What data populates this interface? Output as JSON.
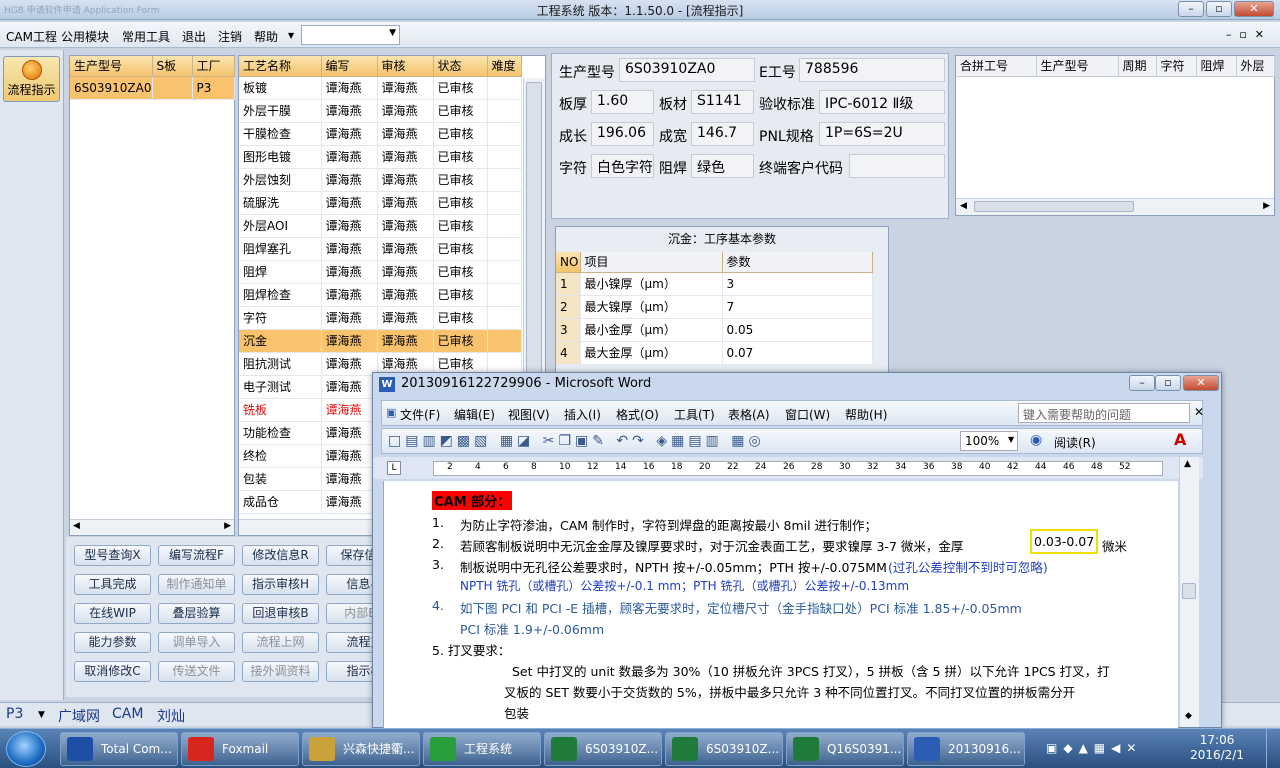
{
  "window": {
    "title": "工程系统  版本：1.1.50.0 - [流程指示]",
    "faded_caption": "HGB 申请软件申请 Application Form"
  },
  "menu": {
    "items": [
      "CAM工程",
      "公用模块",
      "常用工具",
      "退出",
      "注销",
      "帮助"
    ],
    "combo_value": ""
  },
  "nav": {
    "flow_label": "流程指示"
  },
  "product_grid": {
    "columns": [
      "生产型号",
      "S板",
      "工厂"
    ],
    "rows": [
      {
        "model": "6S03910ZA0",
        "sboard": "",
        "factory": "P3"
      }
    ]
  },
  "process_grid": {
    "columns": [
      "工艺名称",
      "编写",
      "审核",
      "状态",
      "难度"
    ],
    "rows": [
      {
        "name": "板镀",
        "writer": "谭海燕",
        "reviewer": "谭海燕",
        "status": "已审核"
      },
      {
        "name": "外层干膜",
        "writer": "谭海燕",
        "reviewer": "谭海燕",
        "status": "已审核"
      },
      {
        "name": "干膜检查",
        "writer": "谭海燕",
        "reviewer": "谭海燕",
        "status": "已审核"
      },
      {
        "name": "图形电镀",
        "writer": "谭海燕",
        "reviewer": "谭海燕",
        "status": "已审核"
      },
      {
        "name": "外层蚀刻",
        "writer": "谭海燕",
        "reviewer": "谭海燕",
        "status": "已审核"
      },
      {
        "name": "硫脲洗",
        "writer": "谭海燕",
        "reviewer": "谭海燕",
        "status": "已审核"
      },
      {
        "name": "外层AOI",
        "writer": "谭海燕",
        "reviewer": "谭海燕",
        "status": "已审核"
      },
      {
        "name": "阻焊塞孔",
        "writer": "谭海燕",
        "reviewer": "谭海燕",
        "status": "已审核"
      },
      {
        "name": "阻焊",
        "writer": "谭海燕",
        "reviewer": "谭海燕",
        "status": "已审核"
      },
      {
        "name": "阻焊检查",
        "writer": "谭海燕",
        "reviewer": "谭海燕",
        "status": "已审核"
      },
      {
        "name": "字符",
        "writer": "谭海燕",
        "reviewer": "谭海燕",
        "status": "已审核"
      },
      {
        "name": "沉金",
        "writer": "谭海燕",
        "reviewer": "谭海燕",
        "status": "已审核"
      },
      {
        "name": "阻抗测试",
        "writer": "谭海燕",
        "reviewer": "谭海燕",
        "status": "已审核"
      },
      {
        "name": "电子测试",
        "writer": "谭海燕",
        "reviewer": "",
        "status": ""
      },
      {
        "name": "铣板",
        "writer": "谭海燕",
        "reviewer": "",
        "status": ""
      },
      {
        "name": "功能检查",
        "writer": "谭海燕",
        "reviewer": "",
        "status": ""
      },
      {
        "name": "终检",
        "writer": "谭海燕",
        "reviewer": "",
        "status": ""
      },
      {
        "name": "包装",
        "writer": "谭海燕",
        "reviewer": "",
        "status": ""
      },
      {
        "name": "成品仓",
        "writer": "谭海燕",
        "reviewer": "",
        "status": ""
      }
    ]
  },
  "buttons": [
    [
      "型号查询X",
      "编写流程F",
      "修改信息R",
      "保存信息"
    ],
    [
      "工具完成",
      "制作通知单",
      "指示审核H",
      "信息导"
    ],
    [
      "在线WIP",
      "叠层验算",
      "回退审核B",
      "内部BC"
    ],
    [
      "能力参数",
      "调单导入",
      "流程上网",
      "流程对"
    ],
    [
      "取消修改C",
      "传送文件",
      "接外调资料",
      "指示检"
    ]
  ],
  "info": {
    "model_label": "生产型号",
    "model": "6S03910ZA0",
    "eno_label": "E工号",
    "eno": "788596",
    "thick_label": "板厚",
    "thick": "1.60",
    "material_label": "板材",
    "material": "S1141",
    "std_label": "验收标准",
    "std": "IPC-6012 Ⅱ级",
    "len_label": "成长",
    "len": "196.06",
    "wid_label": "成宽",
    "wid": "146.7",
    "pnl_label": "PNL规格",
    "pnl": "1P=6S=2U",
    "char_label": "字符",
    "char": "白色字符",
    "mask_label": "阻焊",
    "mask": "绿色",
    "cust_label": "终端客户代码",
    "cust": ""
  },
  "merge_grid": {
    "columns": [
      "合拼工号",
      "生产型号",
      "周期",
      "字符",
      "阻焊",
      "外层"
    ]
  },
  "params": {
    "title": "沉金：工序基本参数",
    "columns": [
      "NO",
      "项目",
      "参数"
    ],
    "rows": [
      {
        "no": "1",
        "item": "最小镍厚（μm）",
        "val": "3"
      },
      {
        "no": "2",
        "item": "最大镍厚（μm）",
        "val": "7"
      },
      {
        "no": "3",
        "item": "最小金厚（μm）",
        "val": "0.05"
      },
      {
        "no": "4",
        "item": "最大金厚（μm）",
        "val": "0.07"
      }
    ]
  },
  "status": {
    "plant": "P3",
    "net": "广域网",
    "module": "CAM",
    "user": "刘灿"
  },
  "word": {
    "title": "20130916122729906 - Microsoft Word",
    "menu": [
      "文件(F)",
      "编辑(E)",
      "视图(V)",
      "插入(I)",
      "格式(O)",
      "工具(T)",
      "表格(A)",
      "窗口(W)",
      "帮助(H)"
    ],
    "help_placeholder": "键入需要帮助的问题",
    "zoom": "100%",
    "read_label": "阅读(R)",
    "ruler": [
      "2",
      "4",
      "6",
      "8",
      "10",
      "12",
      "14",
      "16",
      "18",
      "20",
      "22",
      "24",
      "26",
      "28",
      "30",
      "32",
      "34",
      "36",
      "38",
      "40",
      "42",
      "44",
      "46",
      "48",
      "52"
    ],
    "heading": "CAM 部分：",
    "l1n": "1.",
    "l1": "为防止字符渗油，CAM 制作时，字符到焊盘的距离按最小 8mil 进行制作；",
    "l2n": "2.",
    "l2a": "若顾客制板说明中无沉金金厚及镍厚要求时，对于沉金表面工艺，要求镍厚 3-7 微米，金厚",
    "l2b": "0.03-0.07",
    "l2c": "微米",
    "l3n": "3.",
    "l3a": "制板说明中无孔径公差要求时，NPTH 按+/-0.05mm；PTH 按+/-0.075MM",
    "l3b": "(过孔公差控制不到时可忽略)",
    "l3c": "NPTH 铣孔（或槽孔）公差按+/-0.1 mm；PTH 铣孔（或槽孔）公差按+/-0.13mm",
    "l4n": "4.",
    "l4a": "如下图 PCI 和 PCI -E 插槽，顾客无要求时，定位槽尺寸（金手指缺口处）PCI 标准 1.85+/-0.05mm",
    "l4b": "PCI 标准 1.9+/-0.06mm",
    "l5": "5. 打叉要求：",
    "l6": "Set 中打叉的 unit 数最多为 30%（10 拼板允许 3PCS 打叉），5 拼板（含 5 拼）以下允许 1PCS 打叉，打",
    "l7": "叉板的 SET 数要小于交货数的 5%，拼板中最多只允许 3 种不同位置打叉。不同打叉位置的拼板需分开",
    "l8": "包装"
  },
  "taskbar": {
    "tasks": [
      "Total Com...",
      "Foxmail",
      "兴森快捷衢...",
      "工程系统",
      "6S03910Z...",
      "6S03910Z...",
      "Q16S0391...",
      "20130916..."
    ],
    "time": "17:06",
    "date": "2016/2/1"
  },
  "colors": {
    "accent": "#f3c46d",
    "selected": "#f9c36e",
    "highlight_red": "#ff0000",
    "taskbar": "#29507f"
  }
}
